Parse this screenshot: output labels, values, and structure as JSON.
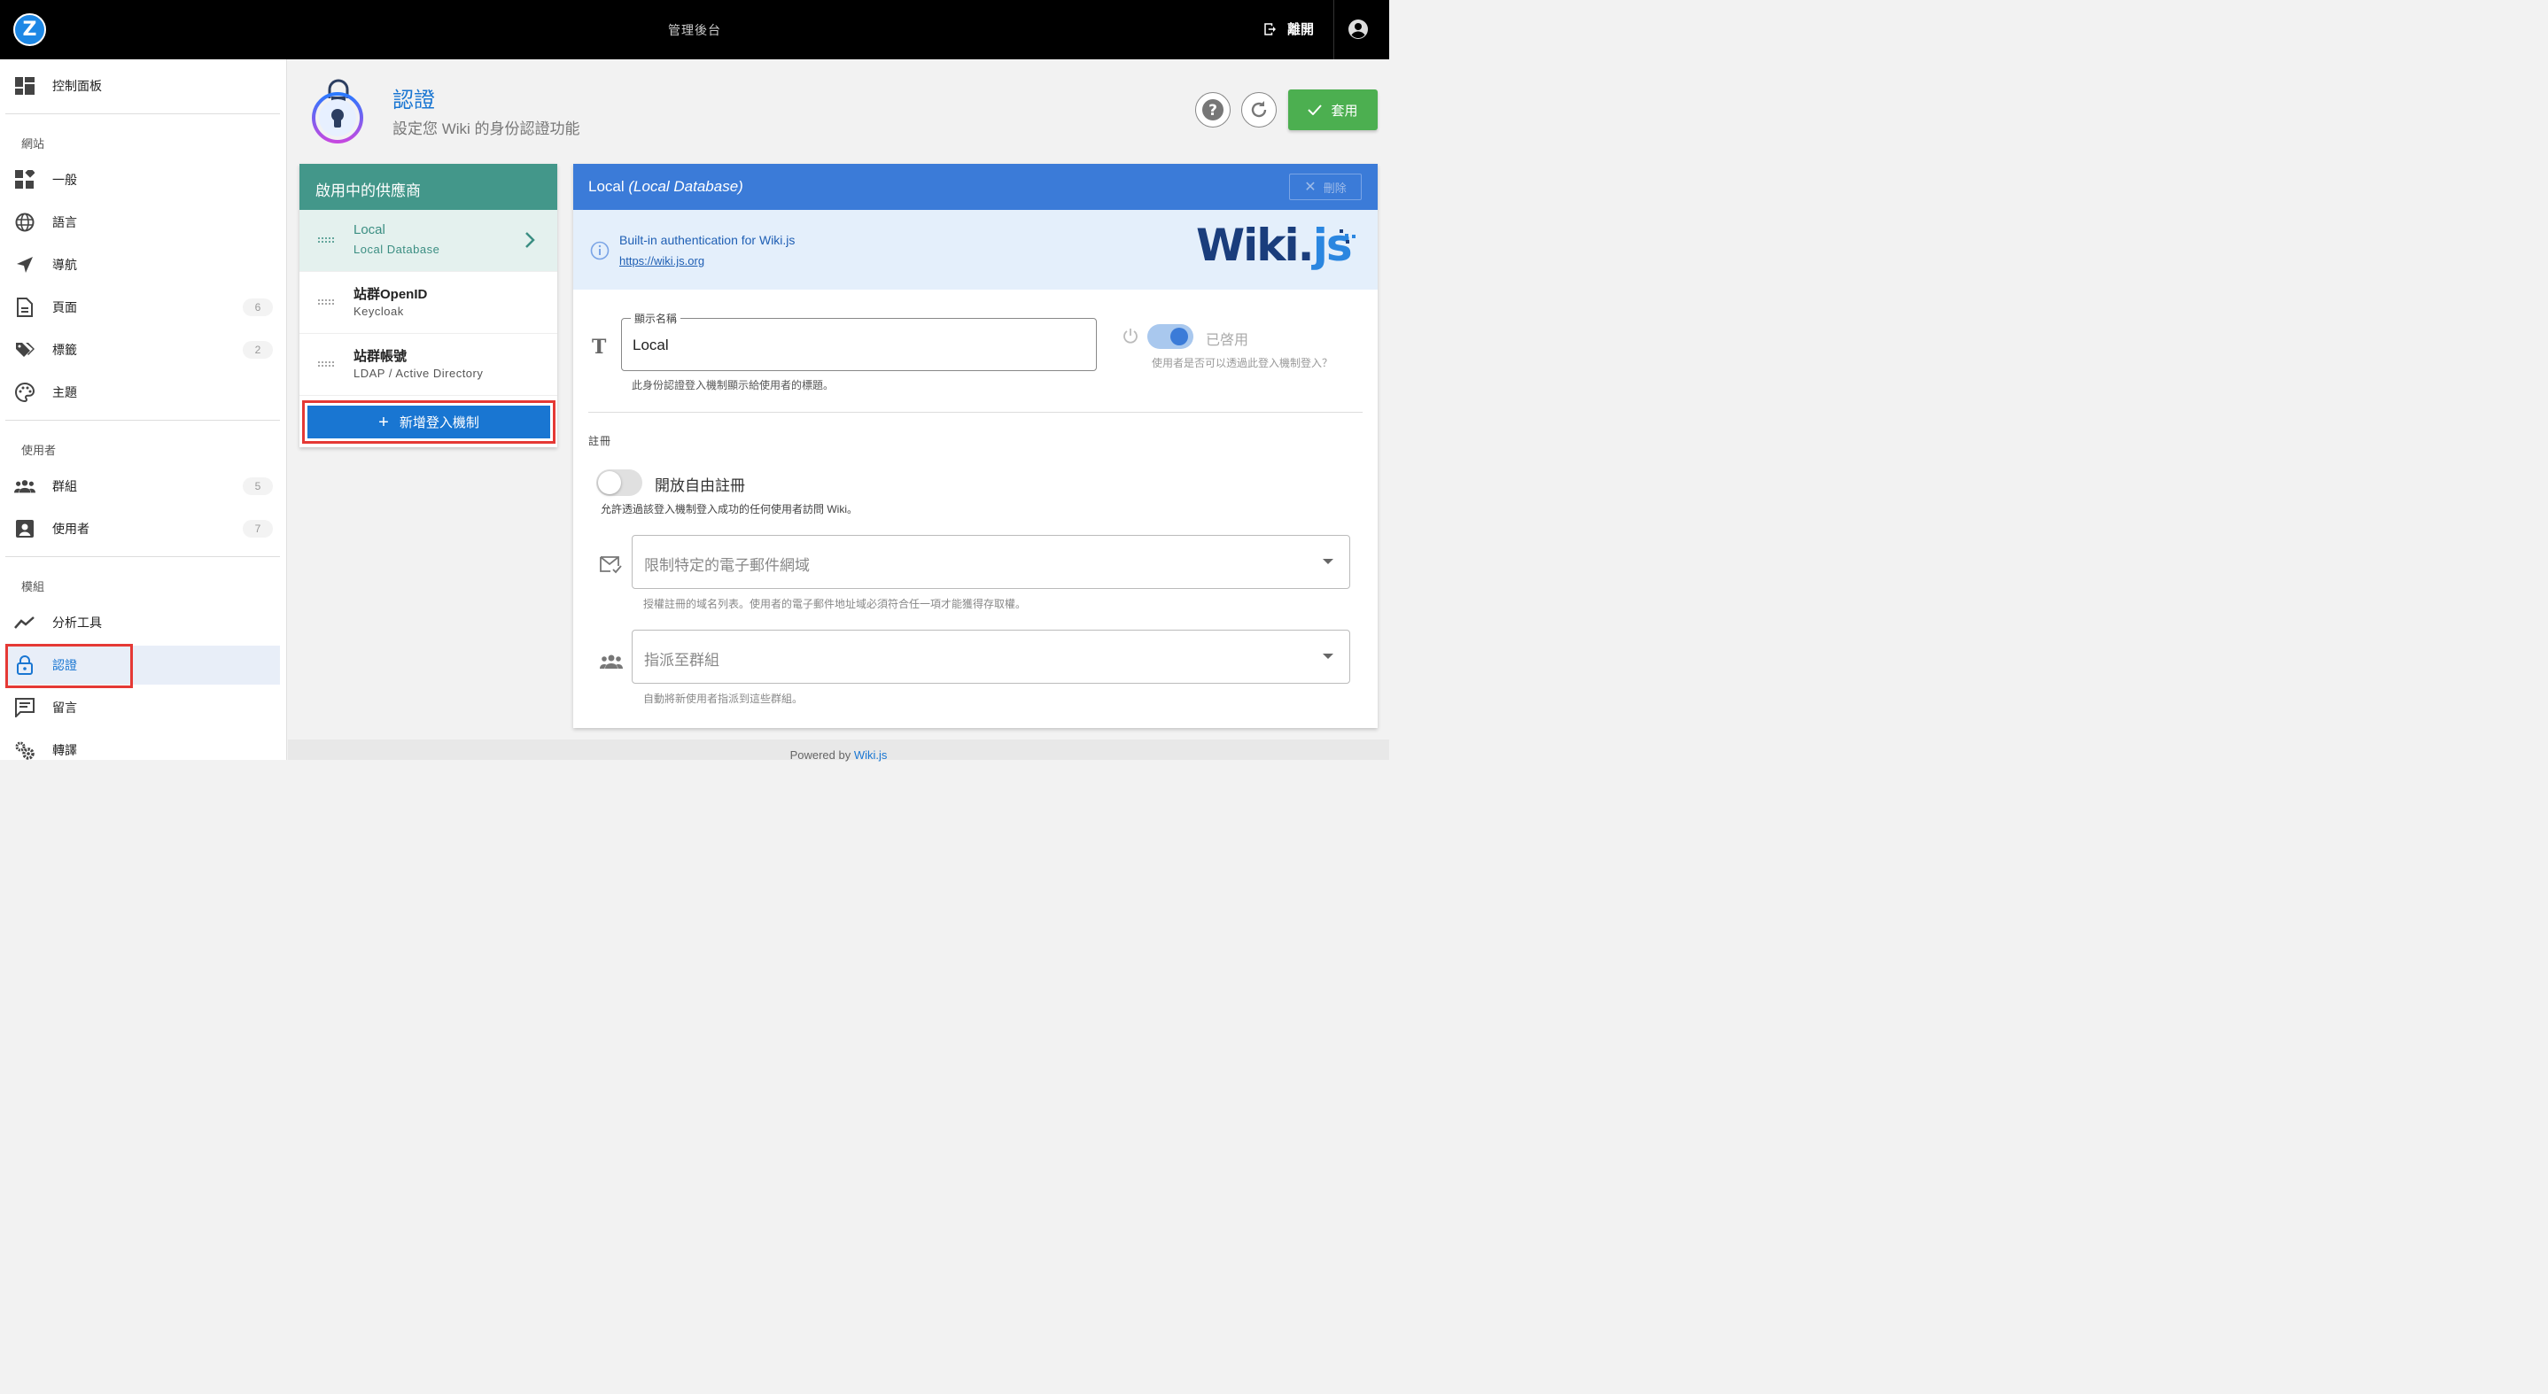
{
  "topbar": {
    "logo_letter": "Z",
    "title": "管理後台",
    "logout_label": "離開"
  },
  "sidebar": {
    "dashboard": "控制面板",
    "sections": {
      "site": "網站",
      "users": "使用者",
      "modules": "模組"
    },
    "items": {
      "general": "一般",
      "locale": "語言",
      "navigation": "導航",
      "pages": "頁面",
      "pages_count": "6",
      "tags": "標籤",
      "tags_count": "2",
      "theme": "主題",
      "groups": "群組",
      "groups_count": "5",
      "users": "使用者",
      "users_count": "7",
      "analytics": "分析工具",
      "auth": "認證",
      "comments": "留言",
      "rendering": "轉譯"
    }
  },
  "header": {
    "title": "認證",
    "subtitle": "設定您 Wiki 的身份認證功能",
    "apply_label": "套用"
  },
  "providers": {
    "title": "啟用中的供應商",
    "items": [
      {
        "name": "Local",
        "desc": "Local Database"
      },
      {
        "name": "站群OpenID",
        "desc": "Keycloak"
      },
      {
        "name": "站群帳號",
        "desc": "LDAP / Active Directory"
      }
    ],
    "add_label": "新增登入機制"
  },
  "detail": {
    "title_main": "Local",
    "title_sub": "(Local Database)",
    "delete_label": "刪除",
    "info_text": "Built-in authentication for Wiki.js",
    "info_link": "https://wiki.js.org",
    "logo_wiki": "Wiki.",
    "logo_js": "js",
    "display_name_label": "顯示名稱",
    "display_name_value": "Local",
    "display_name_hint": "此身份認證登入機制顯示給使用者的標題。",
    "enabled_label": "已啓用",
    "enabled_hint": "使用者是否可以透過此登入機制登入？",
    "registration_title": "註冊",
    "self_reg_label": "開放自由註冊",
    "self_reg_hint": "允許透過該登入機制登入成功的任何使用者訪問 Wiki。",
    "domains_placeholder": "限制特定的電子郵件網域",
    "domains_hint": "授權註冊的域名列表。使用者的電子郵件地址域必須符合任一項才能獲得存取權。",
    "groups_placeholder": "指派至群組",
    "groups_hint": "自動將新使用者指派到這些群組。"
  },
  "footer": {
    "prefix": "Powered by",
    "link": "Wiki.js"
  },
  "colors": {
    "accent": "#1976d2",
    "provider_header": "#43978a",
    "detail_header": "#3b7bd8",
    "apply": "#4caf50",
    "highlight": "#e53935"
  }
}
